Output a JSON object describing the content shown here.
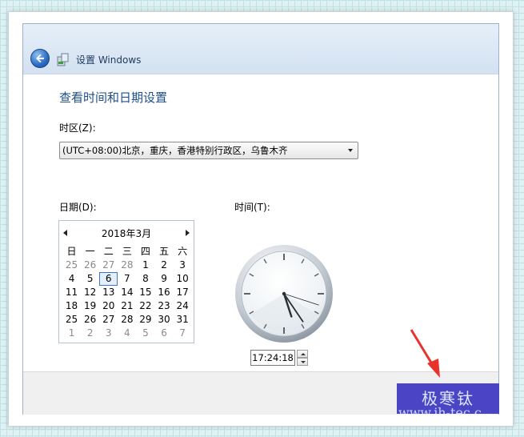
{
  "window": {
    "title": "设置 Windows"
  },
  "page": {
    "heading": "查看时间和日期设置"
  },
  "timezone": {
    "label": "时区(Z):",
    "value": "(UTC+08:00)北京，重庆，香港特别行政区，乌鲁木齐"
  },
  "date": {
    "label": "日期(D):",
    "month_title": "2018年3月",
    "weekdays": [
      "日",
      "一",
      "二",
      "三",
      "四",
      "五",
      "六"
    ],
    "weeks": [
      [
        "25",
        "26",
        "27",
        "28",
        "1",
        "2",
        "3"
      ],
      [
        "4",
        "5",
        "6",
        "7",
        "8",
        "9",
        "10"
      ],
      [
        "11",
        "12",
        "13",
        "14",
        "15",
        "16",
        "17"
      ],
      [
        "18",
        "19",
        "20",
        "21",
        "22",
        "23",
        "24"
      ],
      [
        "25",
        "26",
        "27",
        "28",
        "29",
        "30",
        "31"
      ],
      [
        "1",
        "2",
        "3",
        "4",
        "5",
        "6",
        "7"
      ]
    ],
    "selected_day": "6"
  },
  "time": {
    "label": "时间(T):",
    "value": "17:24:18",
    "hour": 17,
    "minute": 24,
    "second": 18
  },
  "watermark": {
    "line1": "极寒钛",
    "line2": "www.jh-tec.c"
  },
  "colors": {
    "heading": "#1e4f8c",
    "watermark_bg": "#4b45c6",
    "arrow": "#e8332c"
  }
}
